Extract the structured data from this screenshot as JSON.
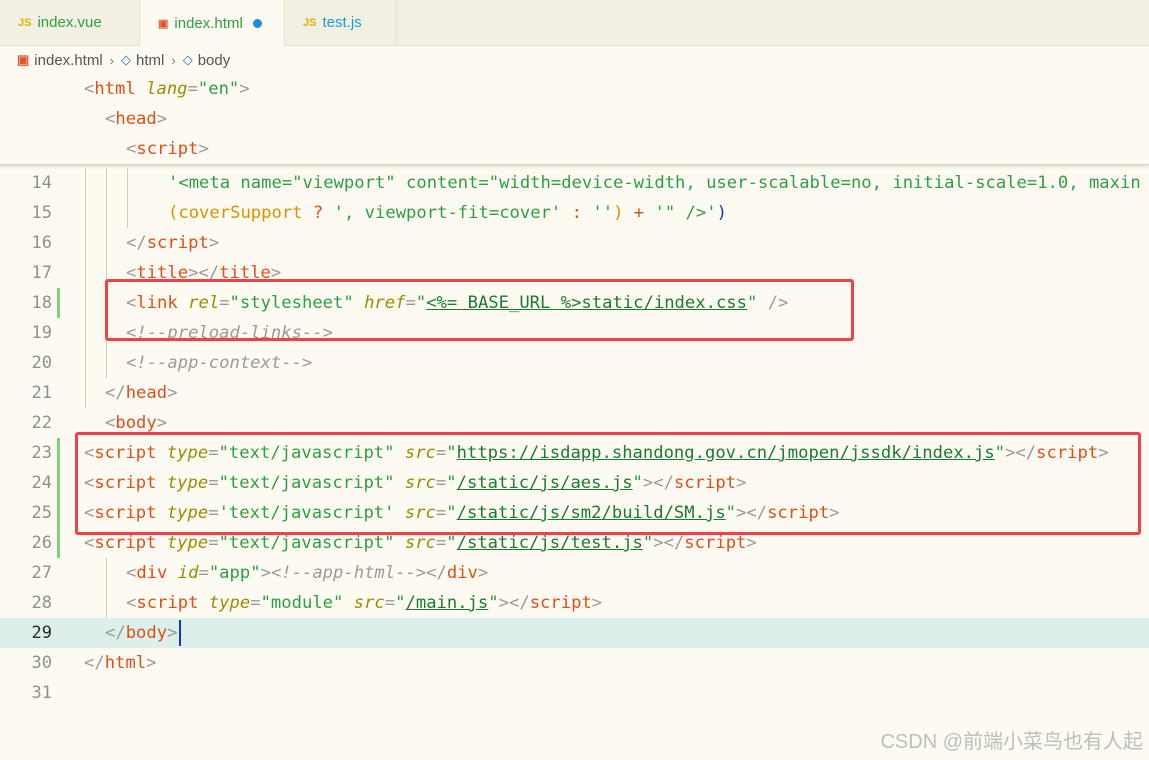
{
  "tabs": [
    {
      "label": "index.vue",
      "icon": "JS",
      "active": false
    },
    {
      "label": "index.html",
      "icon": "5",
      "active": true,
      "modified": true
    },
    {
      "label": "test.js",
      "icon": "JS",
      "active": false
    }
  ],
  "breadcrumb": [
    "index.html",
    "html",
    "body"
  ],
  "sticky_lines": [
    {
      "indent": 0,
      "tag": "html"
    },
    {
      "indent": 1,
      "tag": "head"
    },
    {
      "indent": 2,
      "tag": "script"
    }
  ],
  "editor": {
    "line_numbers": [
      "14",
      "15",
      "16",
      "17",
      "18",
      "19",
      "20",
      "21",
      "22",
      "23",
      "24",
      "25",
      "26",
      "27",
      "28",
      "29",
      "30",
      "31"
    ],
    "current_line": "29",
    "line14_text": "'<meta name=\"viewport\" content=\"width=device-width, user-scalable=no, initial-scale=1.0, maxin",
    "line15_ident": "coverSupport",
    "line15_str1": "', viewport-fit=cover'",
    "line15_str2": "''",
    "line15_str3": "'\" />'",
    "script_tag": "script",
    "title_tag": "title",
    "link_tag": "link",
    "rel_value": "\"stylesheet\"",
    "href_value": "<%= BASE_URL %>static/index.css",
    "comment_preload": "<!--preload-links-->",
    "comment_app_context": "<!--app-context-->",
    "head_tag": "head",
    "body_tag": "body",
    "html_tag": "html",
    "type_js": "\"text/javascript\"",
    "type_js_single": "'text/javascript'",
    "src_jssdk": "https://isdapp.shandong.gov.cn/jmopen/jssdk/index.js",
    "src_aes": "/static/js/aes.js",
    "src_sm": "/static/js/sm2/build/SM.js",
    "src_test": "/static/js/test.js",
    "div_tag": "div",
    "div_id": "\"app\"",
    "comment_app_html": "<!--app-html-->",
    "type_module": "\"module\"",
    "src_main": "/main.js",
    "attr_type": "type",
    "attr_src": "src",
    "attr_rel": "rel",
    "attr_href": "href",
    "attr_id": "id",
    "attr_lang": "lang",
    "lang_value": "\"en\""
  },
  "watermark": "CSDN @前端小菜鸟也有人起",
  "colors": {
    "highlight_box": "#f0404a",
    "tag": "#e04e1b",
    "string": "#2f9e44",
    "attr": "#9a8d05"
  }
}
